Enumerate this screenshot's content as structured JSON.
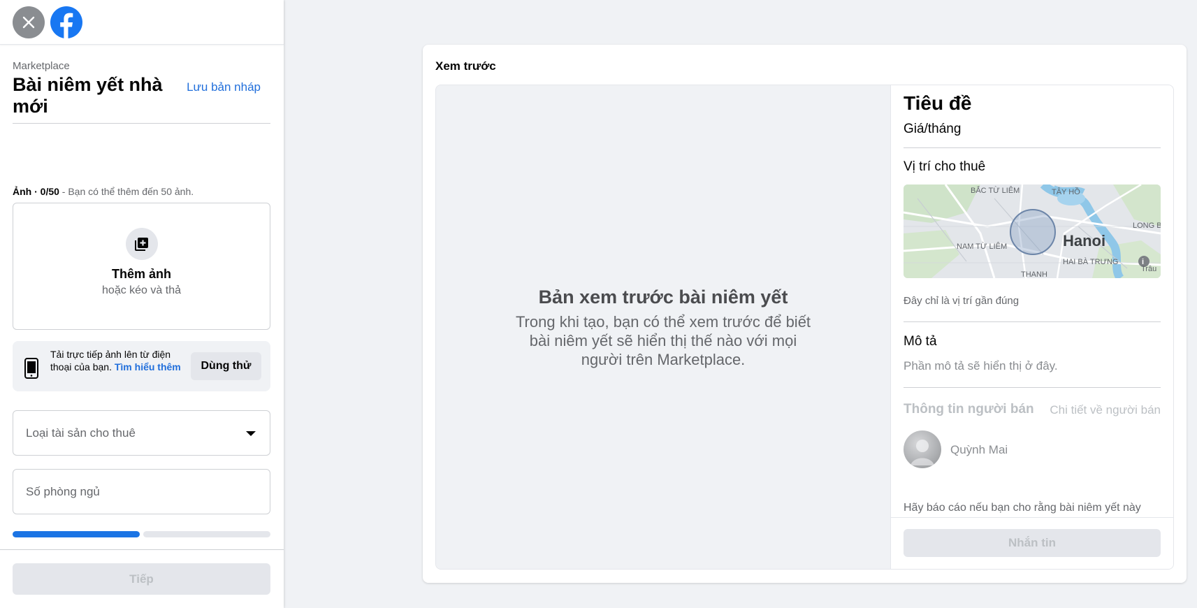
{
  "header": {
    "breadcrumb": "Marketplace",
    "title": "Bài niêm yết nhà mới",
    "save_draft_label": "Lưu bản nháp"
  },
  "photos": {
    "label": "Ảnh · 0/50",
    "hint": " - Bạn có thể thêm đến 50 ảnh.",
    "add_label": "Thêm ảnh",
    "add_sub": "hoặc kéo và thả"
  },
  "mobile_upload": {
    "text": "Tải trực tiếp ảnh lên từ điện thoại của bạn. ",
    "link": "Tìm hiểu thêm",
    "try_label": "Dùng thử"
  },
  "form": {
    "property_type_placeholder": "Loại tài sản cho thuê",
    "bedrooms_placeholder": "Số phòng ngủ"
  },
  "progress": {
    "current_step": 1,
    "total_steps": 2
  },
  "footer": {
    "next_label": "Tiếp"
  },
  "preview": {
    "heading": "Xem trước",
    "empty_title": "Bản xem trước bài niêm yết",
    "empty_text": "Trong khi tạo, bạn có thể xem trước để biết bài niêm yết sẽ hiển thị thế nào với mọi người trên Marketplace.",
    "listing_title": "Tiêu đề",
    "price": "Giá/tháng",
    "location_title": "Vị trí cho thuê",
    "map": {
      "city": "Hanoi",
      "labels": [
        "BẮC TỪ LIÊM",
        "TÂY HỒ",
        "LONG BIÊN",
        "NAM TỪ LIÊM",
        "HAI BÀ TRƯNG",
        "THANH",
        "Trâu"
      ]
    },
    "map_note": "Đây chỉ là vị trí gần đúng",
    "description_title": "Mô tả",
    "description_placeholder": "Phần mô tả sẽ hiển thị ở đây.",
    "seller_title": "Thông tin người bán",
    "seller_details": "Chi tiết về người bán",
    "seller_name": "Quỳnh Mai",
    "report_text": "Hãy báo cáo nếu bạn cho rằng bài niêm yết này",
    "message_label": "Nhắn tin"
  },
  "colors": {
    "accent": "#1b74e4",
    "link": "#216fdb",
    "background": "#f0f2f5"
  },
  "icons": [
    "close-icon",
    "facebook-logo",
    "add-photo-icon",
    "phone-icon",
    "chevron-down-icon",
    "info-icon"
  ]
}
